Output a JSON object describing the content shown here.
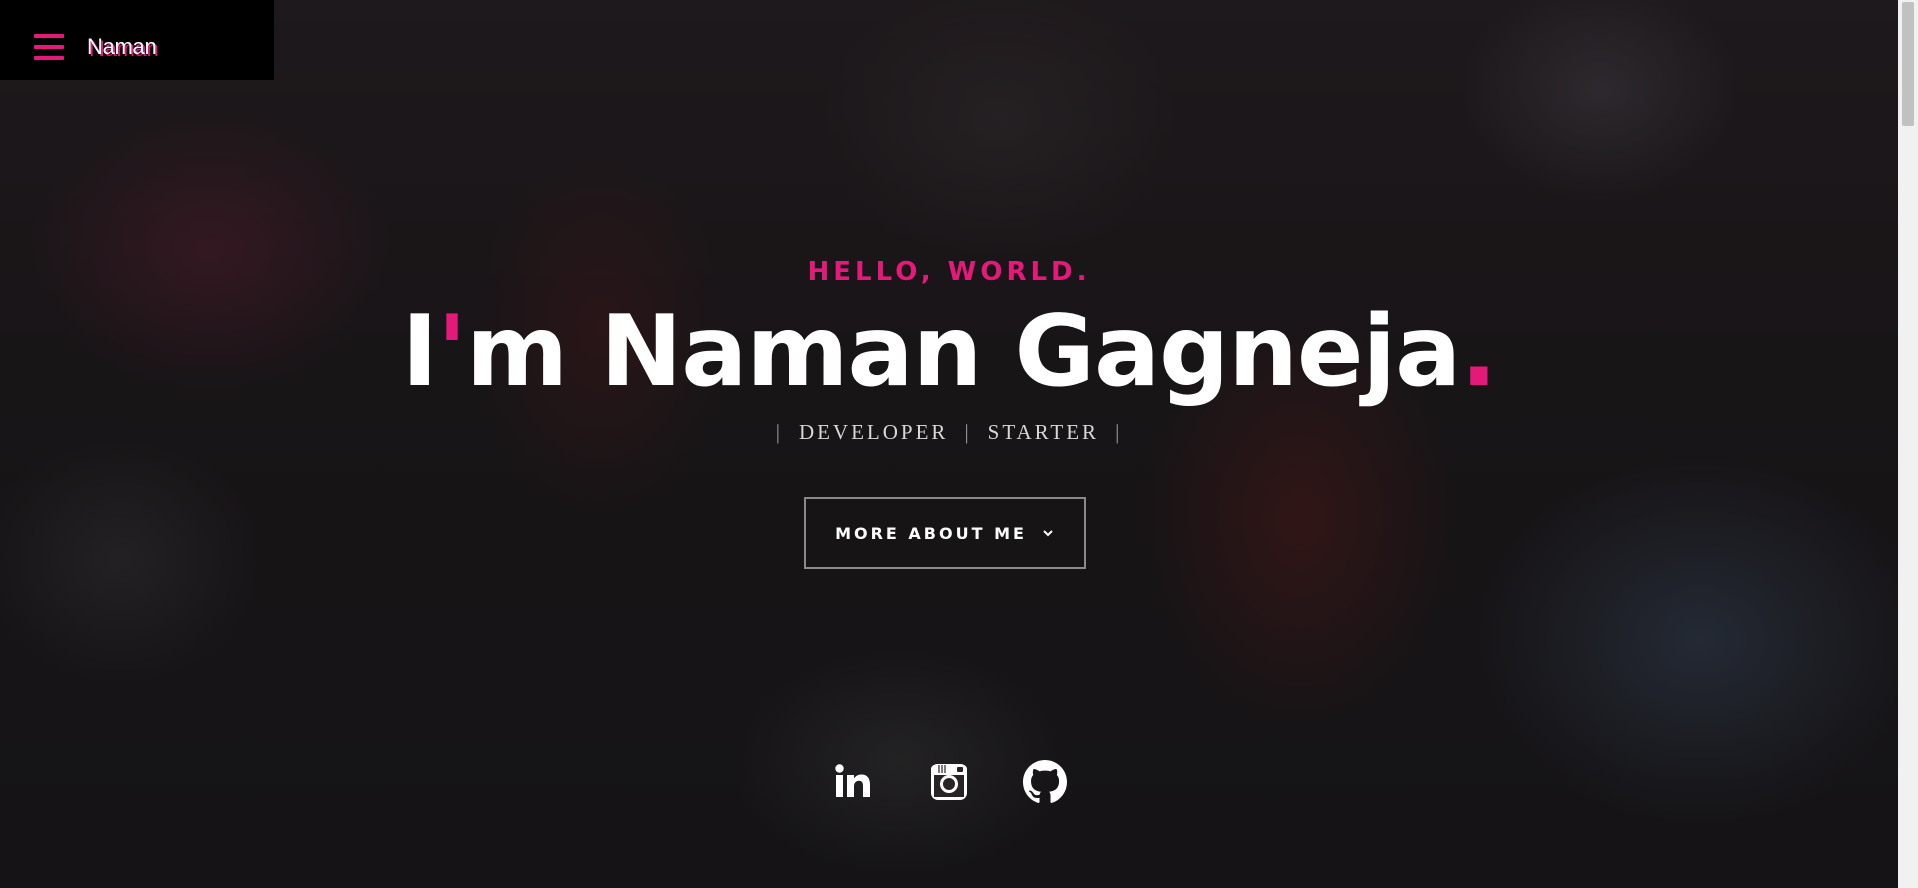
{
  "nav": {
    "brand": "Naman",
    "menu_icon": "hamburger-menu-icon",
    "accent_color": "#e5197a"
  },
  "hero": {
    "greeting": "HELLO, WORLD.",
    "headline_pre": "I",
    "headline_apostrophe": "'",
    "headline_post": "m Naman Gagneja",
    "headline_dot": ".",
    "roles": [
      "DEVELOPER",
      "STARTER"
    ],
    "role_separator": "|",
    "cta_label": "MORE ABOUT ME",
    "cta_icon": "chevron-down-icon"
  },
  "social": [
    {
      "name": "LinkedIn",
      "icon": "linkedin-icon"
    },
    {
      "name": "Instagram",
      "icon": "instagram-icon"
    },
    {
      "name": "GitHub",
      "icon": "github-icon"
    }
  ],
  "colors": {
    "accent": "#e5197a",
    "text": "#ffffff",
    "nav_bg": "#000000"
  }
}
